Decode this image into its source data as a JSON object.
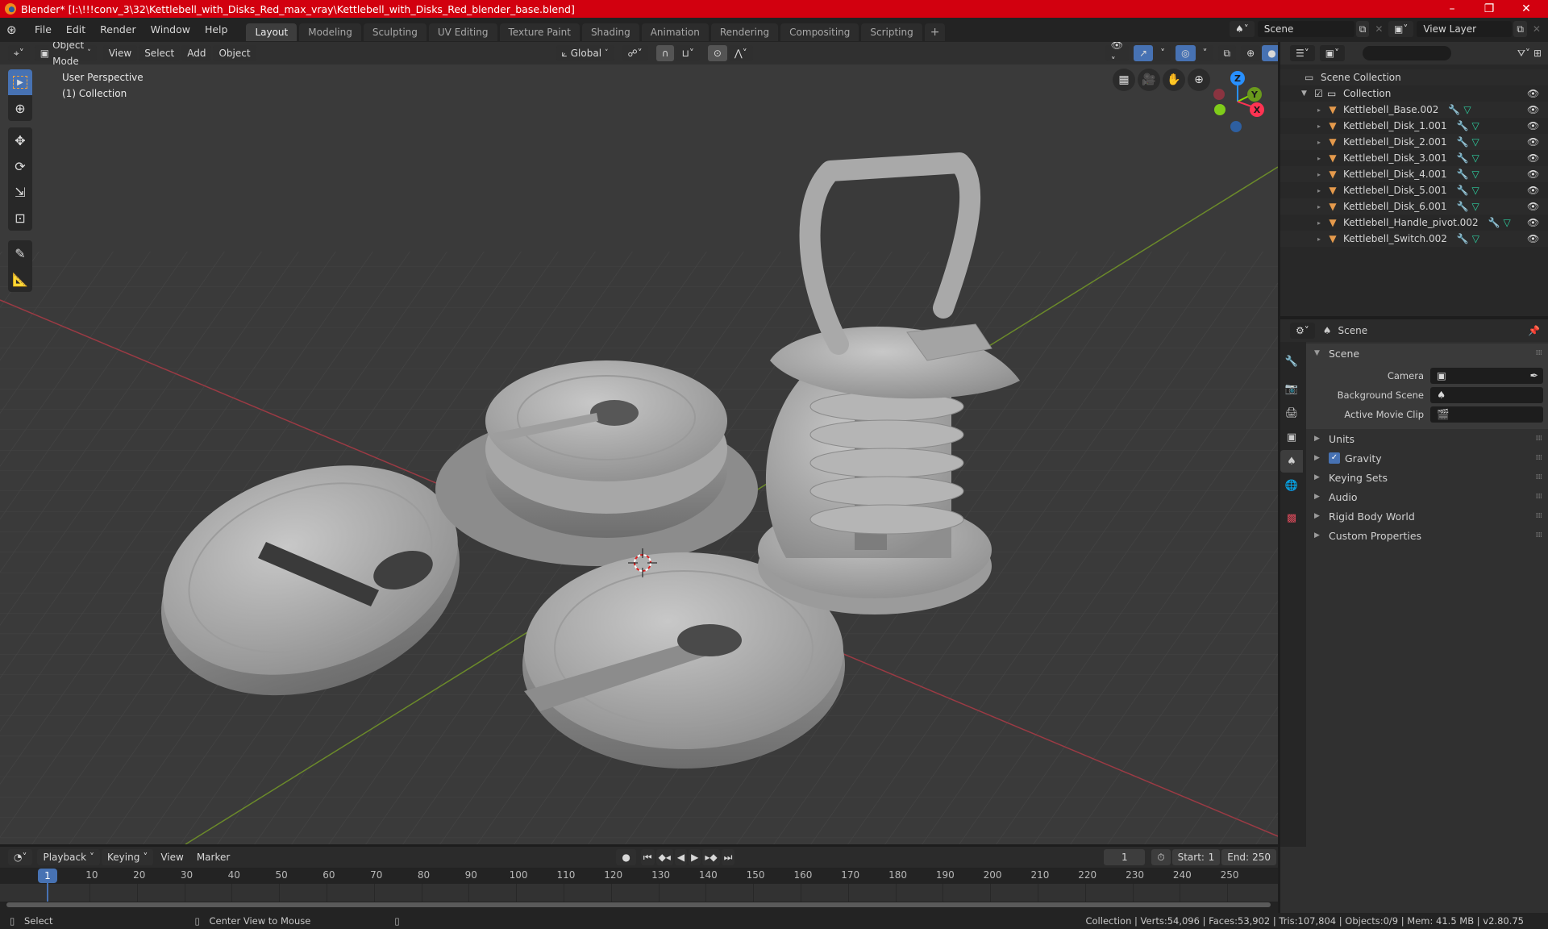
{
  "window": {
    "title": "Blender* [I:\\!!!conv_3\\32\\Kettlebell_with_Disks_Red_max_vray\\Kettlebell_with_Disks_Red_blender_base.blend]",
    "controls": {
      "minimize": "–",
      "maximize": "❐",
      "close": "✕"
    }
  },
  "menu": [
    "File",
    "Edit",
    "Render",
    "Window",
    "Help"
  ],
  "workspaces": {
    "tabs": [
      "Layout",
      "Modeling",
      "Sculpting",
      "UV Editing",
      "Texture Paint",
      "Shading",
      "Animation",
      "Rendering",
      "Compositing",
      "Scripting"
    ],
    "active": "Layout",
    "add_label": "+"
  },
  "scene_selector": {
    "value": "Scene"
  },
  "view_layer_selector": {
    "value": "View Layer"
  },
  "viewport": {
    "mode": "Object Mode",
    "menus": [
      "View",
      "Select",
      "Add",
      "Object"
    ],
    "transform_orientation": "Global",
    "overlay_text": {
      "perspective": "User Perspective",
      "collection": "(1) Collection"
    },
    "gizmo_axes": {
      "z": "Z",
      "y": "Y",
      "x": "X"
    },
    "colors": {
      "x_axis": "#ff3352",
      "y_axis": "#8bdc00",
      "z_axis": "#2890ff",
      "active": "#4772b3"
    }
  },
  "outliner": {
    "search_placeholder": "",
    "root": "Scene Collection",
    "collection": "Collection",
    "objects": [
      "Kettlebell_Base.002",
      "Kettlebell_Disk_1.001",
      "Kettlebell_Disk_2.001",
      "Kettlebell_Disk_3.001",
      "Kettlebell_Disk_4.001",
      "Kettlebell_Disk_5.001",
      "Kettlebell_Disk_6.001",
      "Kettlebell_Handle_pivot.002",
      "Kettlebell_Switch.002"
    ]
  },
  "properties": {
    "context": "Scene",
    "section_scene": "Scene",
    "fields": [
      {
        "label": "Camera",
        "value": ""
      },
      {
        "label": "Background Scene",
        "value": ""
      },
      {
        "label": "Active Movie Clip",
        "value": ""
      }
    ],
    "panels": [
      "Units",
      "Gravity",
      "Keying Sets",
      "Audio",
      "Rigid Body World",
      "Custom Properties"
    ],
    "gravity_checked": true
  },
  "timeline": {
    "menus": [
      "Playback",
      "Keying",
      "View",
      "Marker"
    ],
    "current_frame": "1",
    "start_label": "Start:",
    "start": "1",
    "end_label": "End:",
    "end": "250",
    "ruler": [
      "10",
      "20",
      "30",
      "40",
      "50",
      "60",
      "70",
      "80",
      "90",
      "100",
      "110",
      "120",
      "130",
      "140",
      "150",
      "160",
      "170",
      "180",
      "190",
      "200",
      "210",
      "220",
      "230",
      "240",
      "250"
    ],
    "playhead": "1"
  },
  "statusbar": {
    "select": "Select",
    "center_view": "Center View to Mouse",
    "stats": "Collection | Verts:54,096 | Faces:53,902 | Tris:107,804 | Objects:0/9 | Mem: 41.5 MB | v2.80.75"
  }
}
